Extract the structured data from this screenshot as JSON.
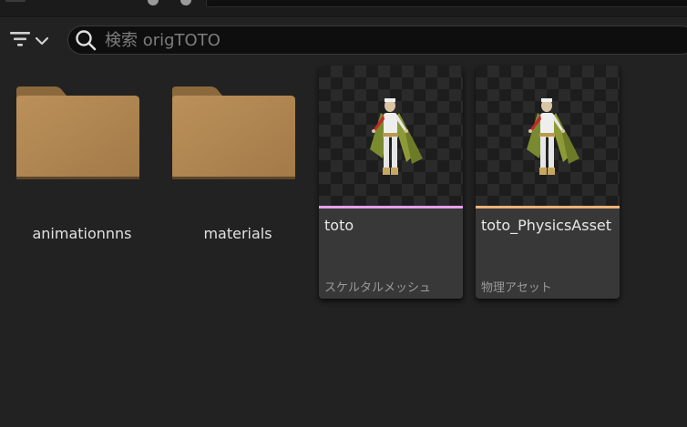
{
  "search": {
    "placeholder": "検索 origTOTO",
    "value": ""
  },
  "toolbar": {
    "filter_icon": "filter-icon",
    "dropdown_icon": "chevron-down-icon",
    "search_icon": "search-icon"
  },
  "folders": [
    {
      "label": "animationnns",
      "icon": "folder-icon"
    },
    {
      "label": "materials",
      "icon": "folder-icon"
    }
  ],
  "assets": [
    {
      "name": "toto",
      "type": "スケルタルメッシュ",
      "type_color": "#e6a0f0"
    },
    {
      "name": "toto_PhysicsAsset",
      "type": "物理アセット",
      "type_color": "#f0b37a"
    }
  ],
  "colors": {
    "background": "#222222",
    "folder": "#b48a55",
    "card": "#383838"
  }
}
